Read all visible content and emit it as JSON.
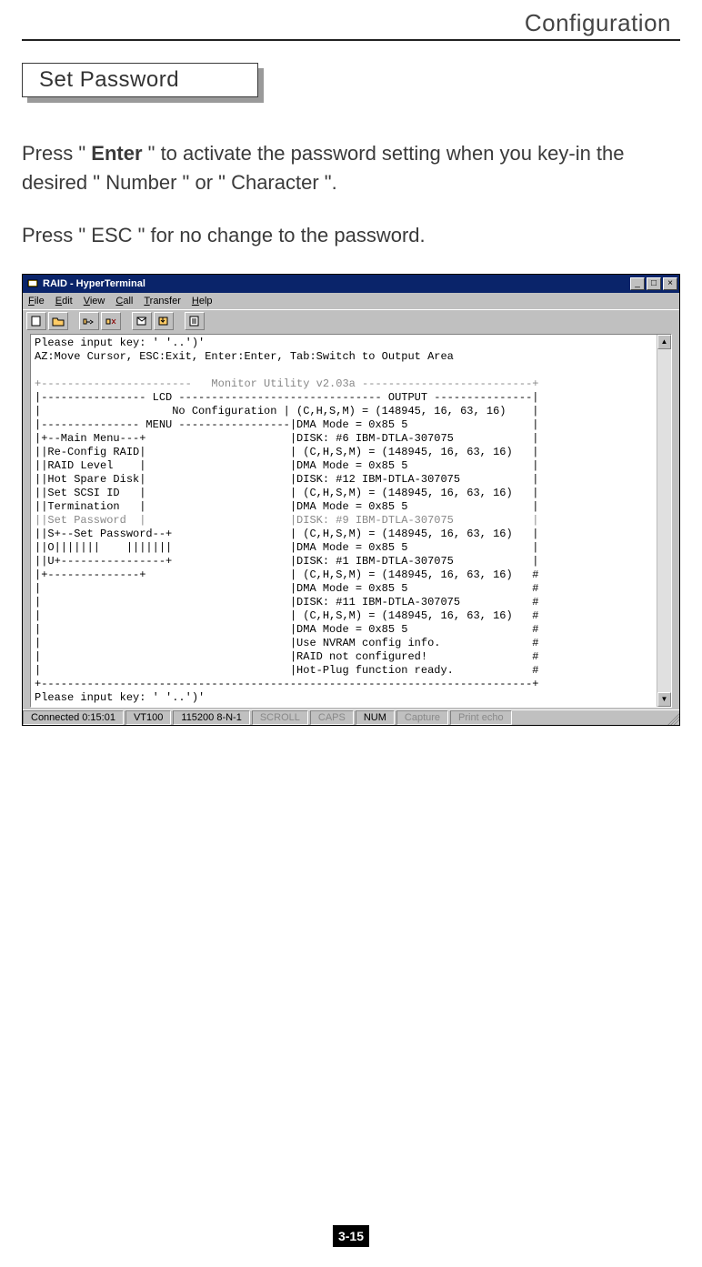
{
  "header": {
    "chapter": "Configuration"
  },
  "section": {
    "title": "Set Password"
  },
  "body": {
    "p1a": "Press \" ",
    "p1b": "Enter",
    "p1c": " \" to activate the password setting when you key-in  the desired \" Number \" or \" Character \".",
    "p2": "Press \" ESC \" for no change to the password."
  },
  "window": {
    "title": "RAID - HyperTerminal",
    "menu": [
      "File",
      "Edit",
      "View",
      "Call",
      "Transfer",
      "Help"
    ],
    "terminal_lines": [
      "Please input key: ' '..')'",
      "AZ:Move Cursor, ESC:Exit, Enter:Enter, Tab:Switch to Output Area",
      "",
      "+-----------------------   Monitor Utility v2.03a --------------------------+",
      "|---------------- LCD ------------------------------- OUTPUT ---------------|",
      "|                    No Configuration | (C,H,S,M) = (148945, 16, 63, 16)    |",
      "|--------------- MENU -----------------|DMA Mode = 0x85 5                   |",
      "|+--Main Menu---+                      |DISK: #6 IBM-DTLA-307075            |",
      "||Re-Config RAID|                      | (C,H,S,M) = (148945, 16, 63, 16)   |",
      "||RAID Level    |                      |DMA Mode = 0x85 5                   |",
      "||Hot Spare Disk|                      |DISK: #12 IBM-DTLA-307075           |",
      "||Set SCSI ID   |                      | (C,H,S,M) = (148945, 16, 63, 16)   |",
      "||Termination   |                      |DMA Mode = 0x85 5                   |",
      "||Set Password  |                      |DISK: #9 IBM-DTLA-307075            |",
      "||S+--Set Password--+                  | (C,H,S,M) = (148945, 16, 63, 16)   |",
      "||O|||||||    |||||||                  |DMA Mode = 0x85 5                   |",
      "||U+----------------+                  |DISK: #1 IBM-DTLA-307075            |",
      "|+--------------+                      | (C,H,S,M) = (148945, 16, 63, 16)   #",
      "|                                      |DMA Mode = 0x85 5                   #",
      "|                                      |DISK: #11 IBM-DTLA-307075           #",
      "|                                      | (C,H,S,M) = (148945, 16, 63, 16)   #",
      "|                                      |DMA Mode = 0x85 5                   #",
      "|                                      |Use NVRAM config info.              #",
      "|                                      |RAID not configured!                #",
      "|                                      |Hot-Plug function ready.            #",
      "+---------------------------------------------------------------------------+",
      "Please input key: ' '..')'"
    ],
    "gray_lines": [
      3,
      13
    ],
    "status": {
      "connected": "Connected 0:15:01",
      "emulation": "VT100",
      "port": "115200 8-N-1",
      "scroll": "SCROLL",
      "caps": "CAPS",
      "num": "NUM",
      "capture": "Capture",
      "printecho": "Print echo"
    }
  },
  "page_number": "3-15"
}
